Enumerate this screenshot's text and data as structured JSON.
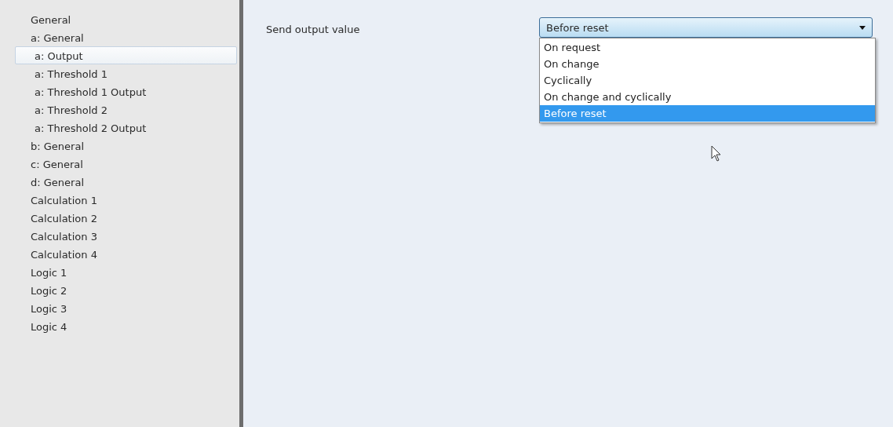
{
  "sidebar": {
    "items": [
      {
        "label": "General",
        "selected": false
      },
      {
        "label": "a: General",
        "selected": false,
        "children": [
          {
            "label": "a: Output",
            "selected": true
          },
          {
            "label": "a: Threshold 1",
            "selected": false
          },
          {
            "label": "a: Threshold 1 Output",
            "selected": false
          },
          {
            "label": "a: Threshold 2",
            "selected": false
          },
          {
            "label": "a: Threshold 2 Output",
            "selected": false
          }
        ]
      },
      {
        "label": "b: General",
        "selected": false
      },
      {
        "label": "c: General",
        "selected": false
      },
      {
        "label": "d: General",
        "selected": false
      },
      {
        "label": "Calculation 1",
        "selected": false
      },
      {
        "label": "Calculation 2",
        "selected": false
      },
      {
        "label": "Calculation 3",
        "selected": false
      },
      {
        "label": "Calculation 4",
        "selected": false
      },
      {
        "label": "Logic 1",
        "selected": false
      },
      {
        "label": "Logic 2",
        "selected": false
      },
      {
        "label": "Logic 3",
        "selected": false
      },
      {
        "label": "Logic 4",
        "selected": false
      }
    ]
  },
  "parameter": {
    "label": "Send output value",
    "value": "Before reset",
    "expanded": true,
    "options": [
      {
        "label": "On request",
        "selected": false
      },
      {
        "label": "On change",
        "selected": false
      },
      {
        "label": "Cyclically",
        "selected": false
      },
      {
        "label": "On change and cyclically",
        "selected": false
      },
      {
        "label": "Before reset",
        "selected": true
      }
    ]
  }
}
